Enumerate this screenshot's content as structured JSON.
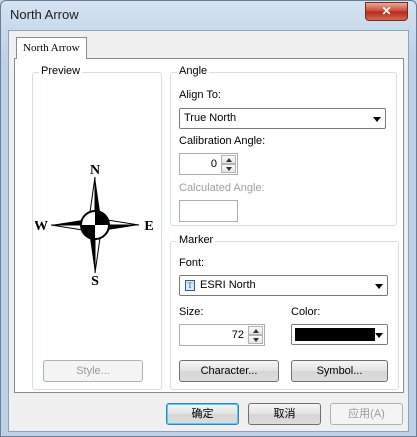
{
  "window": {
    "title": "North Arrow",
    "close_glyph": "✕"
  },
  "tabs": [
    {
      "label": "North Arrow"
    }
  ],
  "preview": {
    "legend": "Preview",
    "style_button": "Style...",
    "compass": {
      "north": "N",
      "south": "S",
      "east": "E",
      "west": "W"
    }
  },
  "angle": {
    "legend": "Angle",
    "align_to_label": "Align To:",
    "align_to_value": "True North",
    "calibration_label": "Calibration Angle:",
    "calibration_value": "0",
    "calculated_label": "Calculated Angle:",
    "calculated_value": ""
  },
  "marker": {
    "legend": "Marker",
    "font_label": "Font:",
    "font_value": "ESRI North",
    "font_icon_glyph": "T",
    "size_label": "Size:",
    "size_value": "72",
    "color_label": "Color:",
    "color_value": "#000000",
    "character_button": "Character...",
    "symbol_button": "Symbol..."
  },
  "footer": {
    "ok": "确定",
    "cancel": "取消",
    "apply": "应用(A)"
  },
  "colors": {
    "titlebar": "#c7d7e8",
    "close": "#c8452f",
    "default_button_border": "#3c7fb1"
  }
}
